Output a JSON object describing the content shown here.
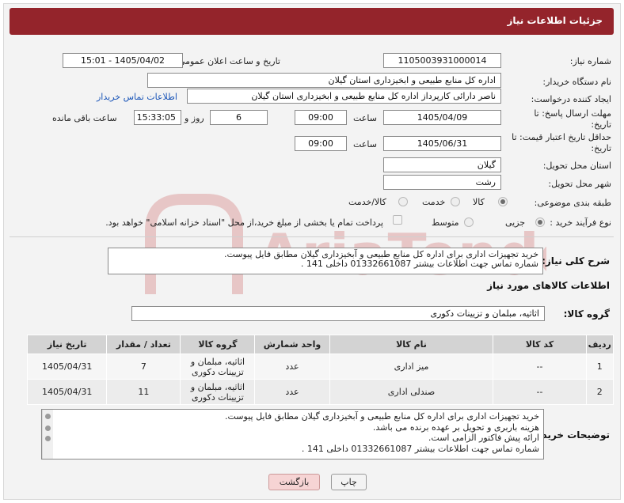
{
  "title": "جزئیات اطلاعات نیاز",
  "watermark": "AriaTender.net",
  "form": {
    "need_number_label": "شماره نیاز:",
    "need_number": "1105003931000014",
    "announce_label": "تاریخ و ساعت اعلان عمومی:",
    "announce_value": "1405/04/02 - 15:01",
    "buyer_org_label": "نام دستگاه خریدار:",
    "buyer_org": "اداره کل منابع طبیعی و ابخیزداری استان گیلان",
    "creator_label": "ایجاد کننده درخواست:",
    "creator": "ناصر  دارائی کارپرداز اداره کل منابع طبیعی و ابخیزداری استان گیلان",
    "contact_link": "اطلاعات تماس خریدار",
    "deadline_label": "مهلت ارسال پاسخ: تا تاریخ:",
    "deadline_date": "1405/04/09",
    "time_label": "ساعت",
    "deadline_time": "09:00",
    "days_value": "6",
    "days_label": "روز و",
    "remaining_time": "15:33:05",
    "remaining_label": "ساعت باقی مانده",
    "validity_label": "حداقل تاریخ اعتبار قیمت: تا تاریخ:",
    "validity_date": "1405/06/31",
    "validity_time": "09:00",
    "province_label": "استان محل تحویل:",
    "province": "گیلان",
    "city_label": "شهر محل تحویل:",
    "city": "رشت",
    "category_label": "طبقه بندی موضوعی:",
    "category_options": [
      "کالا",
      "خدمت",
      "کالا/خدمت"
    ],
    "purchase_type_label": "نوع فرآیند خرید :",
    "purchase_options": [
      "جزیی",
      "متوسط"
    ],
    "payment_note": "پرداخت تمام یا بخشی از مبلغ خرید،از محل \"اسناد خزانه اسلامی\" خواهد بود."
  },
  "description": {
    "label": "شرح کلی نیاز:",
    "lines": [
      "خرید تجهیزات اداری برای اداره کل منابع طبیعی و آبخیزداری گیلان مطابق فایل پیوست.",
      "شماره تماس جهت اطلاعات بیشتر 01332661087 داخلی 141 ."
    ]
  },
  "goods": {
    "section_title": "اطلاعات کالاهای مورد نیاز",
    "group_label": "گروه کالا:",
    "group_value": "اثاثیه، مبلمان و تزیینات دکوری",
    "columns": [
      "ردیف",
      "کد کالا",
      "نام کالا",
      "واحد شمارش",
      "گروه کالا",
      "تعداد / مقدار",
      "تاریخ نیاز"
    ],
    "rows": [
      {
        "row": "1",
        "code": "--",
        "name": "میز اداری",
        "unit": "عدد",
        "group": "اثاثیه، مبلمان و تزیینات دکوری",
        "qty": "7",
        "date": "1405/04/31"
      },
      {
        "row": "2",
        "code": "--",
        "name": "صندلی اداری",
        "unit": "عدد",
        "group": "اثاثیه، مبلمان و تزیینات دکوری",
        "qty": "11",
        "date": "1405/04/31"
      }
    ]
  },
  "buyer_notes": {
    "label": "توضیحات خریدار:",
    "lines": [
      "خرید تجهیزات اداری برای اداره کل منابع طبیعی و آبخیزداری گیلان مطابق فایل پیوست.",
      "هزینه باربری و تحویل بر عهده برنده می باشد.",
      "ارائه پیش فاکتور الزامی است.",
      "شماره تماس جهت اطلاعات بیشتر 01332661087 داخلی 141 ."
    ]
  },
  "buttons": {
    "print": "چاپ",
    "back": "بازگشت"
  },
  "colors": {
    "header": "#94242b",
    "link": "#1a55b8",
    "back_button": "#f6d4d4"
  }
}
